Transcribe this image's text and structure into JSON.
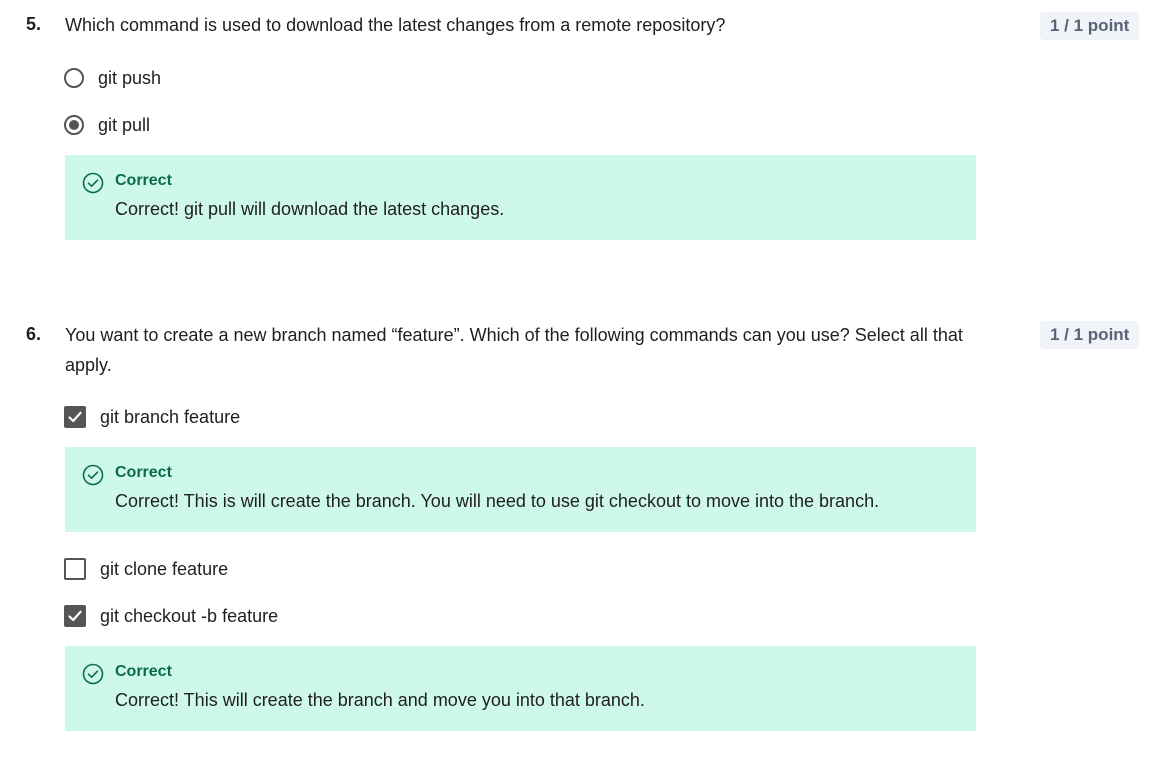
{
  "questions": [
    {
      "number": "5.",
      "text": "Which command is used to download the latest changes from a remote repository?",
      "points": "1 / 1 point",
      "options": [
        {
          "label": "git push",
          "type": "radio",
          "checked": false
        },
        {
          "label": "git pull",
          "type": "radio",
          "checked": true
        }
      ],
      "feedback": [
        {
          "title": "Correct",
          "text": "Correct! git pull will download the latest changes."
        }
      ]
    },
    {
      "number": "6.",
      "text": "You want to create a new branch named “feature”. Which of the following commands can you use? Select all that apply.",
      "points": "1 / 1 point",
      "options": [
        {
          "label": "git branch feature",
          "type": "checkbox",
          "checked": true
        },
        {
          "label": "git clone feature",
          "type": "checkbox",
          "checked": false
        },
        {
          "label": "git checkout -b feature",
          "type": "checkbox",
          "checked": true
        }
      ],
      "feedback": [
        {
          "title": "Correct",
          "text": "Correct! This is will create the branch. You will need to use git checkout to move into the branch."
        },
        {
          "title": "Correct",
          "text": "Correct! This will create the branch and move you into that branch."
        }
      ]
    }
  ],
  "colors": {
    "feedback_bg": "#cff8ec",
    "correct_green": "#0a6c4b",
    "points_bg": "#f0f4f8",
    "points_text": "#586376",
    "control_gray": "#555555"
  },
  "icons": {
    "feedback": "check-circle-icon",
    "checkbox_checked": "checkmark-icon"
  }
}
